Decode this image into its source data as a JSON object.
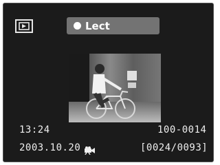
{
  "screen": {
    "mode_icon": "playback-icon",
    "play_button": {
      "label": "Lect",
      "icon": "record-dot-icon"
    },
    "thumbnail": "movie-thumbnail-cyclist",
    "time": "13:24",
    "file_number": "100-0014",
    "date": "2003.10.20",
    "media_icon": "movie-camera-icon",
    "frame_counter": "[0024/0093]"
  },
  "colors": {
    "lcd_bg": "#1b1b1b",
    "button_bg": "#737373",
    "text": "#efefef"
  }
}
